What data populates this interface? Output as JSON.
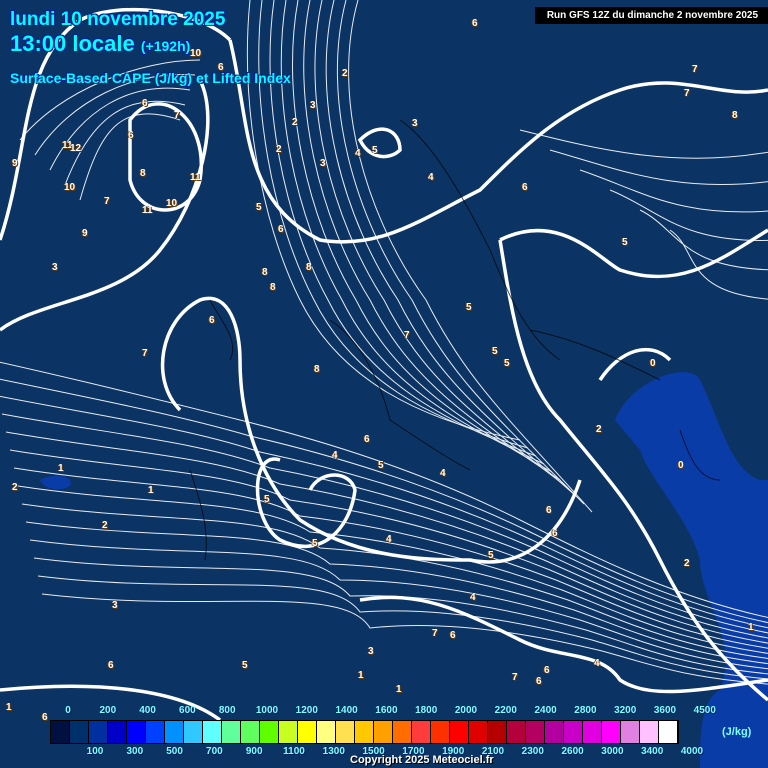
{
  "header": {
    "date": "lundi 10 novembre 2025",
    "time": "13:00 locale",
    "lead": "(+192h)",
    "parameter": "Surface-Based CAPE (J/kg) et Lifted Index",
    "run": "Run GFS 12Z du dimanche 2 novembre 2025"
  },
  "legend": {
    "unit": "(J/kg)",
    "top_ticks": [
      "0",
      "200",
      "400",
      "600",
      "800",
      "1000",
      "1200",
      "1400",
      "1600",
      "1800",
      "2000",
      "2200",
      "2400",
      "2800",
      "3200",
      "3600",
      "4500"
    ],
    "bottom_ticks": [
      "100",
      "300",
      "500",
      "700",
      "900",
      "1100",
      "1300",
      "1500",
      "1700",
      "1900",
      "2100",
      "2300",
      "2600",
      "3000",
      "3400",
      "4000"
    ],
    "colors": [
      "#001040",
      "#00306c",
      "#0030a0",
      "#0000c8",
      "#0000ff",
      "#0040ff",
      "#0090ff",
      "#30c8ff",
      "#60ffff",
      "#60ff9c",
      "#60ff60",
      "#60ff00",
      "#c8ff20",
      "#ffff00",
      "#ffff80",
      "#ffe050",
      "#ffc800",
      "#ffa000",
      "#ff6c00",
      "#ff3c3c",
      "#ff3000",
      "#ff0000",
      "#e00000",
      "#b40000",
      "#b4003c",
      "#b40060",
      "#b400a0",
      "#c800c8",
      "#e000e0",
      "#ff00ff",
      "#e080e0",
      "#ffc0ff",
      "#ffffff"
    ]
  },
  "copyright": "Copyright 2025 Meteociel.fr",
  "map": {
    "background": "#0b3464",
    "cape_color": "#0a3ca8",
    "li_labels": [
      "9",
      "11",
      "12",
      "10",
      "7",
      "9",
      "11",
      "8",
      "6",
      "6",
      "7",
      "11",
      "10",
      "10",
      "6",
      "5",
      "6",
      "2",
      "2",
      "3",
      "2",
      "3",
      "4",
      "5",
      "3",
      "4",
      "6",
      "6",
      "7",
      "7",
      "8",
      "8",
      "8",
      "8",
      "5",
      "6",
      "7",
      "7",
      "8",
      "5",
      "5",
      "5",
      "0",
      "2",
      "0",
      "3",
      "4",
      "1",
      "2",
      "6",
      "5",
      "4",
      "5",
      "6",
      "6",
      "4",
      "5",
      "5",
      "4",
      "7",
      "6",
      "3",
      "1",
      "1",
      "2",
      "1",
      "1",
      "2",
      "3",
      "6",
      "5",
      "1",
      "7",
      "6",
      "6",
      "6",
      "4"
    ]
  }
}
